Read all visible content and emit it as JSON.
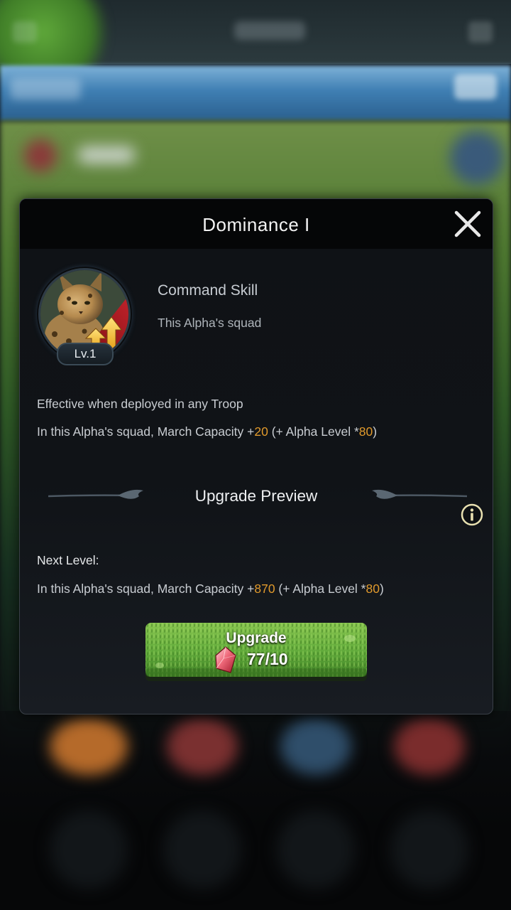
{
  "modal": {
    "title": "Dominance I",
    "skill_type": "Command Skill",
    "skill_scope": "This Alpha's squad",
    "level_badge": "Lv.1",
    "effect_condition": "Effective when deployed in any Troop",
    "current_effect": {
      "prefix": "In this Alpha's squad, March Capacity +",
      "base_value": "20",
      "middle": " (+ Alpha Level *",
      "per_level_value": "80",
      "suffix": ")"
    },
    "upgrade_preview_title": "Upgrade Preview",
    "next_level_label": "Next Level:",
    "next_effect": {
      "prefix": "In this Alpha's squad, March Capacity +",
      "base_value": "870",
      "middle": " (+ Alpha Level *",
      "per_level_value": "80",
      "suffix": ")"
    },
    "upgrade_button": {
      "label": "Upgrade",
      "cost": "77/10",
      "cost_icon": "red-gem-icon"
    }
  },
  "colors": {
    "highlight_number": "#e19a2c",
    "modal_background": "#101317",
    "header_background": "#050607",
    "button_green": "#5fa93a"
  },
  "icons": {
    "close": "close-icon",
    "info": "info-icon",
    "skill": "serval-portrait-arrow-up-icon",
    "gem": "red-gem-icon"
  }
}
